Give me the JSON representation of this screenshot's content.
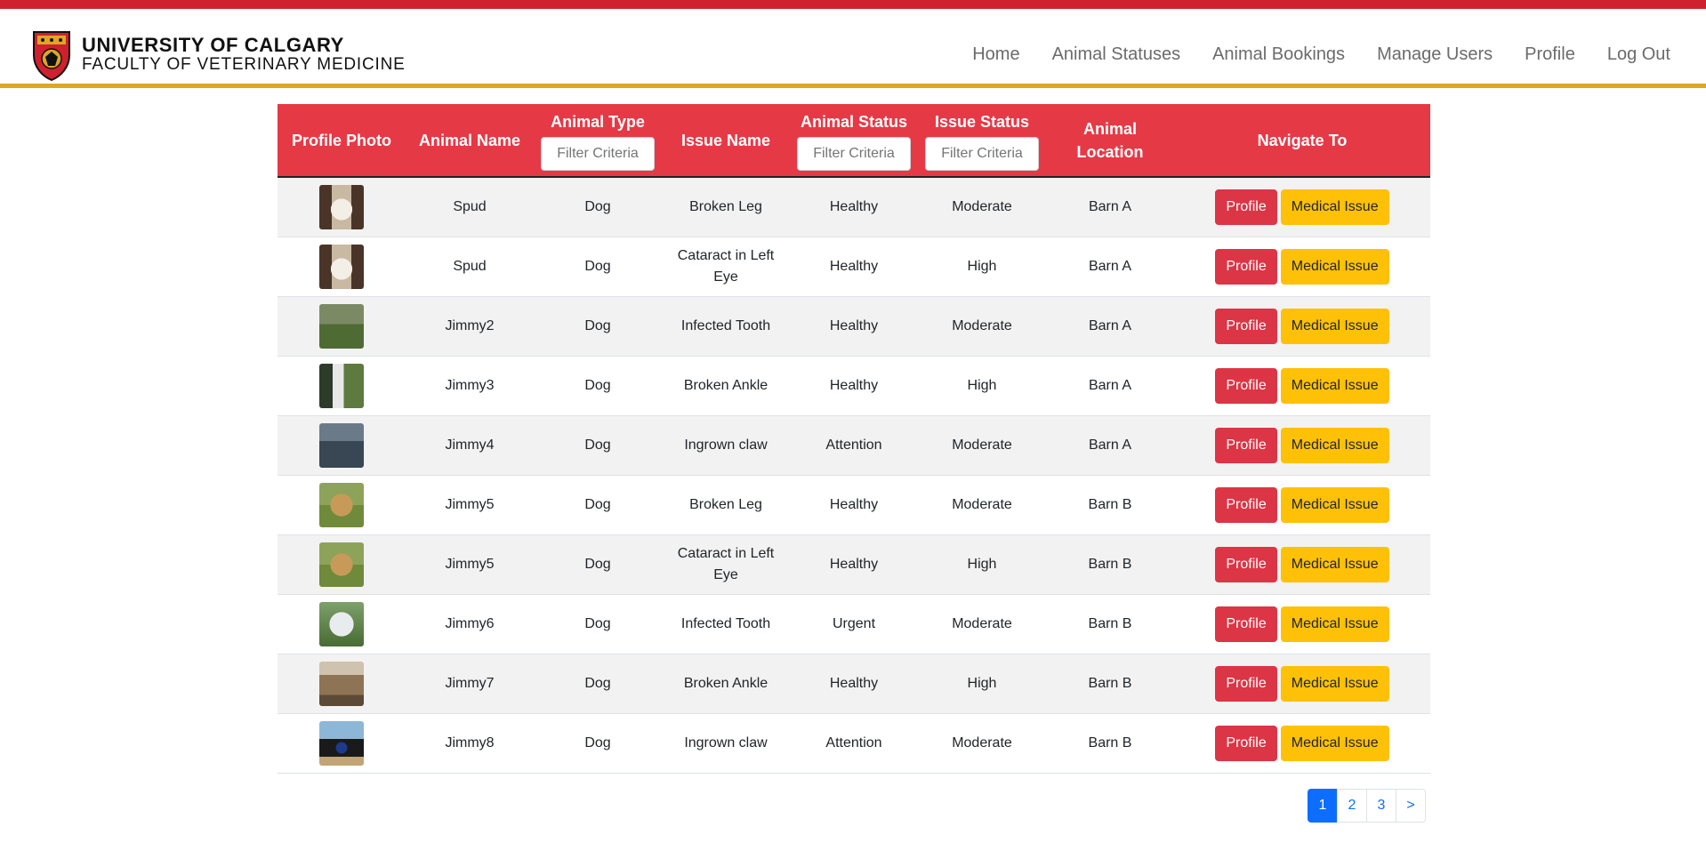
{
  "brand": {
    "line1": "UNIVERSITY OF CALGARY",
    "line2": "FACULTY OF VETERINARY MEDICINE",
    "primary_color": "#cf202f",
    "accent_color": "#e0a526"
  },
  "nav": {
    "items": [
      "Home",
      "Animal Statuses",
      "Animal Bookings",
      "Manage Users",
      "Profile",
      "Log Out"
    ]
  },
  "table": {
    "headers": {
      "photo": "Profile Photo",
      "name": "Animal Name",
      "type": "Animal Type",
      "issue": "Issue Name",
      "status": "Animal Status",
      "issue_status": "Issue Status",
      "location": "Animal Location",
      "navigate": "Navigate To"
    },
    "filter_placeholder": "Filter Criteria",
    "profile_label": "Profile",
    "medical_label": "Medical Issue",
    "rows": [
      {
        "photo": "dog-photo",
        "name": "Spud",
        "type": "Dog",
        "issue": "Broken Leg",
        "status": "Healthy",
        "issue_status": "Moderate",
        "location": "Barn A"
      },
      {
        "photo": "dog-photo",
        "name": "Spud",
        "type": "Dog",
        "issue": "Cataract in Left Eye",
        "status": "Healthy",
        "issue_status": "High",
        "location": "Barn A"
      },
      {
        "photo": "dog-photo",
        "name": "Jimmy2",
        "type": "Dog",
        "issue": "Infected Tooth",
        "status": "Healthy",
        "issue_status": "Moderate",
        "location": "Barn A"
      },
      {
        "photo": "dog-photo",
        "name": "Jimmy3",
        "type": "Dog",
        "issue": "Broken Ankle",
        "status": "Healthy",
        "issue_status": "High",
        "location": "Barn A"
      },
      {
        "photo": "dog-photo",
        "name": "Jimmy4",
        "type": "Dog",
        "issue": "Ingrown claw",
        "status": "Attention",
        "issue_status": "Moderate",
        "location": "Barn A"
      },
      {
        "photo": "dog-photo",
        "name": "Jimmy5",
        "type": "Dog",
        "issue": "Broken Leg",
        "status": "Healthy",
        "issue_status": "Moderate",
        "location": "Barn B"
      },
      {
        "photo": "dog-photo",
        "name": "Jimmy5",
        "type": "Dog",
        "issue": "Cataract in Left Eye",
        "status": "Healthy",
        "issue_status": "High",
        "location": "Barn B"
      },
      {
        "photo": "dog-photo",
        "name": "Jimmy6",
        "type": "Dog",
        "issue": "Infected Tooth",
        "status": "Urgent",
        "issue_status": "Moderate",
        "location": "Barn B"
      },
      {
        "photo": "dog-photo",
        "name": "Jimmy7",
        "type": "Dog",
        "issue": "Broken Ankle",
        "status": "Healthy",
        "issue_status": "High",
        "location": "Barn B"
      },
      {
        "photo": "dog-photo",
        "name": "Jimmy8",
        "type": "Dog",
        "issue": "Ingrown claw",
        "status": "Attention",
        "issue_status": "Moderate",
        "location": "Barn B"
      }
    ]
  },
  "pagination": {
    "pages": [
      "1",
      "2",
      "3"
    ],
    "next": ">",
    "active": "1"
  }
}
